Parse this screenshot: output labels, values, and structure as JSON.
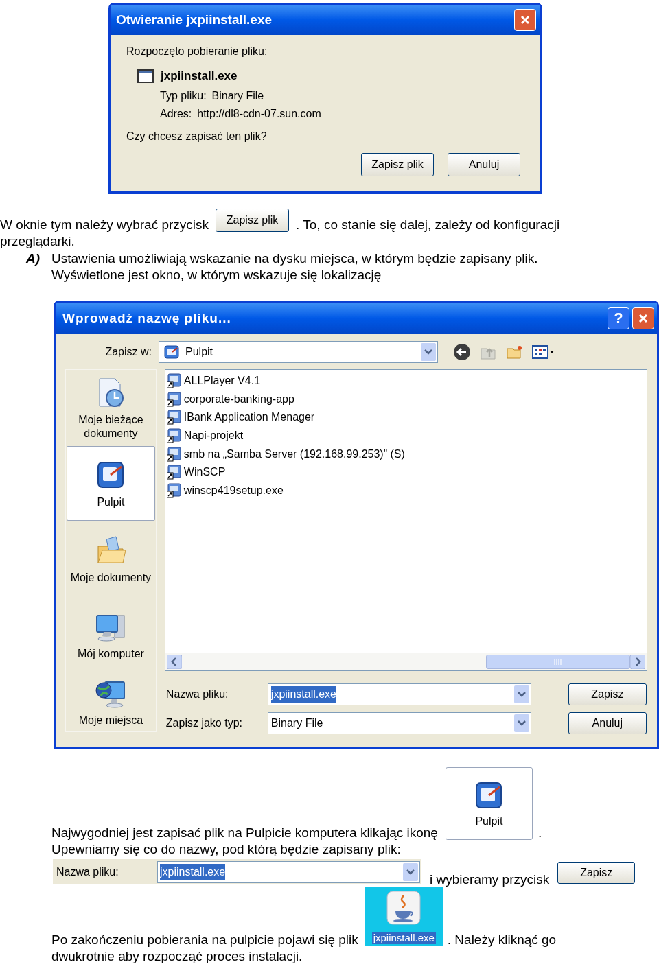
{
  "download_dialog": {
    "title": "Otwieranie jxpiinstall.exe",
    "intro": "Rozpoczęto pobieranie pliku:",
    "file_name": "jxpiinstall.exe",
    "type_label": "Typ pliku:",
    "type_value": "Binary File",
    "address_label": "Adres:",
    "address_value": "http://dl8-cdn-07.sun.com",
    "question": "Czy chcesz zapisać ten plik?",
    "buttons": [
      "Zapisz plik",
      "Anuluj"
    ]
  },
  "intro_paragraph": {
    "before": "W oknie tym należy wybrać przycisk",
    "button": "Zapisz plik",
    "after": ". To, co stanie się dalej, zależy od konfiguracji",
    "continuation": "przeglądarki."
  },
  "option_a": {
    "marker": "A)",
    "text": "Ustawienia umożliwiają wskazanie na dysku miejsca, w którym będzie zapisany plik. Wyświetlone jest okno, w którym wskazuje się lokalizację"
  },
  "save_dialog": {
    "title": "Wprowadź nazwę pliku...",
    "help": "?",
    "save_in_label": "Zapisz w:",
    "save_in_value": "Pulpit",
    "places": [
      {
        "kind": "recent",
        "label": "Moje bieżące dokumenty",
        "selected": false
      },
      {
        "kind": "desktop",
        "label": "Pulpit",
        "selected": true
      },
      {
        "kind": "documents",
        "label": "Moje dokumenty",
        "selected": false
      },
      {
        "kind": "computer",
        "label": "Mój komputer",
        "selected": false
      },
      {
        "kind": "network",
        "label": "Moje miejsca",
        "selected": false
      }
    ],
    "files": [
      "ALLPlayer V4.1",
      "corporate-banking-app",
      "IBank Application Menager",
      "Napi-projekt",
      "smb na „Samba Server (192.168.99.253)” (S)",
      "WinSCP",
      "winscp419setup.exe"
    ],
    "file_name_label": "Nazwa pliku:",
    "file_name_value": "jxpiinstall.exe",
    "file_name_highlighted": true,
    "type_label": "Zapisz jako typ:",
    "type_value": "Binary File",
    "buttons": [
      "Zapisz",
      "Anuluj"
    ]
  },
  "desktop_paragraph": {
    "text": "Najwygodniej jest zapisać plik na Pulpicie komputera klikając ikonę",
    "icon_label": "Pulpit",
    "end": ".",
    "next": "Upewniamy się co do nazwy, pod którą będzie zapisany plik:"
  },
  "name_row": {
    "label": "Nazwa pliku:",
    "value": "jxpiinstall.exe",
    "highlighted": true,
    "text": "i wybieramy przycisk",
    "button": "Zapisz"
  },
  "final_paragraph": {
    "before": "Po zakończeniu pobierania na pulpicie pojawi się plik",
    "icon_label": "jxpiinstall.exe",
    "after": ". Należy kliknąć go",
    "next": "dwukrotnie aby rozpocząć proces instalacji."
  }
}
